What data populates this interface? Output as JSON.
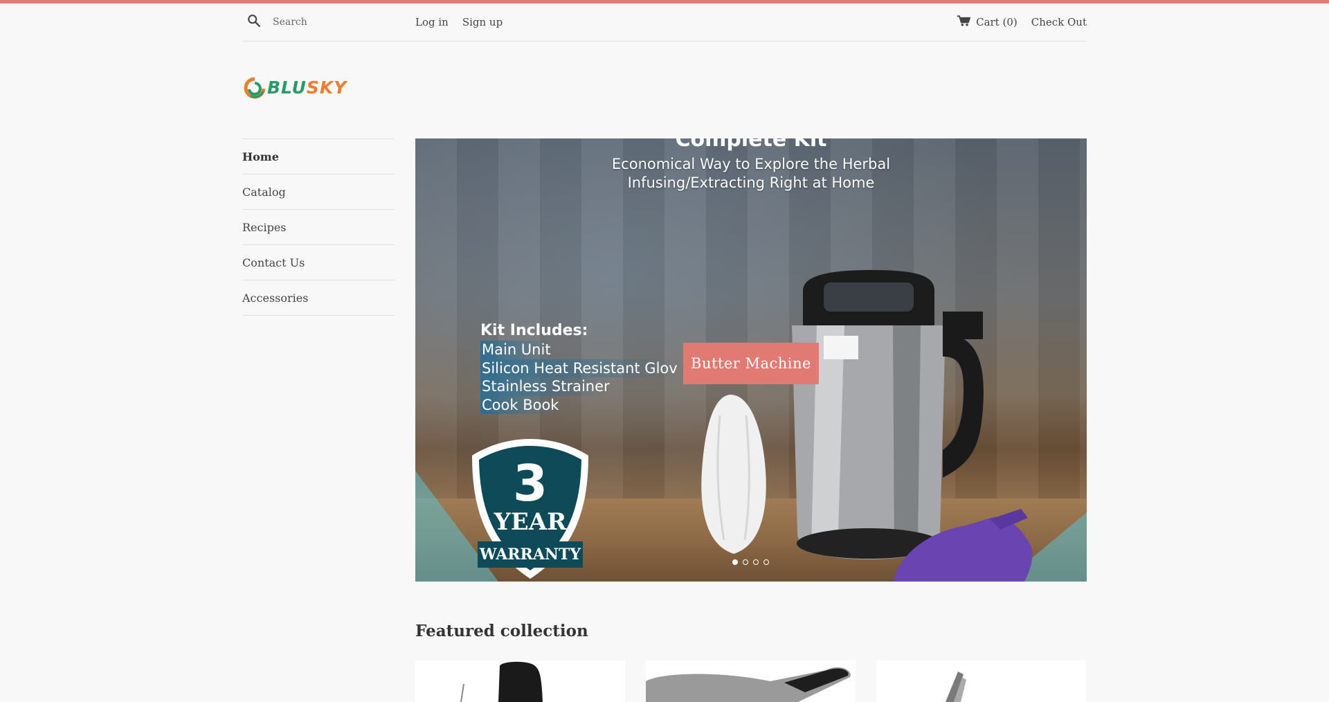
{
  "header": {
    "search_placeholder": "Search",
    "login_label": "Log in",
    "signup_label": "Sign up",
    "cart_label": "Cart (0)",
    "checkout_label": "Check Out"
  },
  "logo": {
    "text_part1": "BLU",
    "text_part2": "SKY"
  },
  "sidebar": {
    "items": [
      {
        "label": "Home"
      },
      {
        "label": "Catalog"
      },
      {
        "label": "Recipes"
      },
      {
        "label": "Contact Us"
      },
      {
        "label": "Accessories"
      }
    ]
  },
  "slideshow": {
    "headline_cut": "Complete Kit",
    "subline_1": "Economical Way to Explore the Herbal",
    "subline_2": "Infusing/Extracting Right at Home",
    "kit_title": "Kit Includes:",
    "kit_items": [
      "Main Unit",
      "Silicon Heat Resistant Glov",
      "Stainless Strainer",
      "Cook Book"
    ],
    "badge_number": "3",
    "badge_year": "YEAR",
    "badge_warranty": "WARRANTY",
    "cta_label": "Butter Machine",
    "slide_count": 4,
    "active_slide": 1
  },
  "featured": {
    "title": "Featured collection"
  },
  "colors": {
    "accent": "#e07a73",
    "logo_green": "#2a9a6a",
    "logo_orange": "#ee7d2f",
    "badge_teal": "#0f4a58",
    "background": "#f8f8f8"
  },
  "icons": {
    "search": "search-icon",
    "cart": "cart-icon"
  }
}
